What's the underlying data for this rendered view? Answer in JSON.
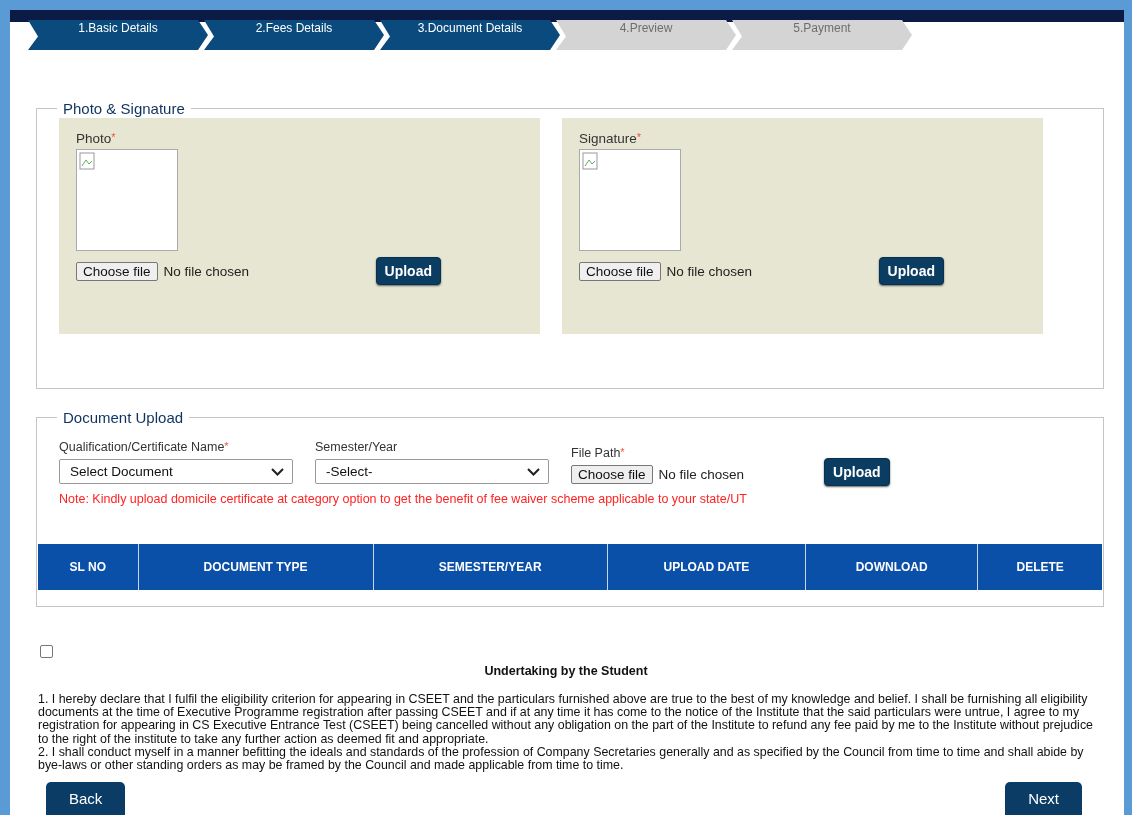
{
  "steps": [
    {
      "label": "1.Basic Details",
      "enabled": true
    },
    {
      "label": "2.Fees Details",
      "enabled": true
    },
    {
      "label": "3.Document Details",
      "enabled": true
    },
    {
      "label": "4.Preview",
      "enabled": false
    },
    {
      "label": "5.Payment",
      "enabled": false
    }
  ],
  "photo_signature": {
    "legend": "Photo & Signature",
    "panels": [
      {
        "label": "Photo",
        "required_mark": "*",
        "choose_button": "Choose file",
        "file_status": "No file chosen",
        "upload_button": "Upload"
      },
      {
        "label": "Signature",
        "required_mark": "*",
        "choose_button": "Choose file",
        "file_status": "No file chosen",
        "upload_button": "Upload"
      }
    ]
  },
  "document_upload": {
    "legend": "Document Upload",
    "fields": [
      {
        "kind": "select",
        "label": "Qualification/Certificate Name",
        "required_mark": "*",
        "value": "Select Document"
      },
      {
        "kind": "select",
        "label": "Semester/Year",
        "value": "-Select-"
      },
      {
        "kind": "file",
        "label": "File Path",
        "required_mark": "*",
        "choose_button": "Choose file",
        "file_status": "No file chosen"
      }
    ],
    "upload_button": "Upload",
    "note": "Note: Kindly upload domicile certificate at category option to get the benefit of fee waiver scheme applicable to your state/UT",
    "table": {
      "columns": [
        "SL NO",
        "DOCUMENT TYPE",
        "SEMESTER/YEAR",
        "UPLOAD DATE",
        "DOWNLOAD",
        "DELETE"
      ]
    }
  },
  "undertaking": {
    "checked": false,
    "title": "Undertaking by the Student",
    "paragraphs": [
      "1. I hereby declare that I fulfil the eligibility criterion for appearing in CSEET and the particulars furnished above are true to the best of my knowledge and belief. I shall be furnishing all eligibility documents at the time of Executive Programme registration after passing CSEET and if at any time it has come to the notice of the Institute that the said particulars were untrue, I agree to my registration for appearing in CS Executive Entrance Test (CSEET) being cancelled without any obligation on the part of the Institute to refund any fee paid by me to the Institute without prejudice to the right of the institute to take any further action as deemed fit and appropriate.",
      "2. I shall conduct myself in a manner befitting the ideals and standards of the profession of Company Secretaries generally and as specified by the Council from time to time and shall abide by bye-laws or other standing orders as may be framed by the Council and made applicable from time to time."
    ]
  },
  "buttons": {
    "back": "Back",
    "next": "Next"
  }
}
